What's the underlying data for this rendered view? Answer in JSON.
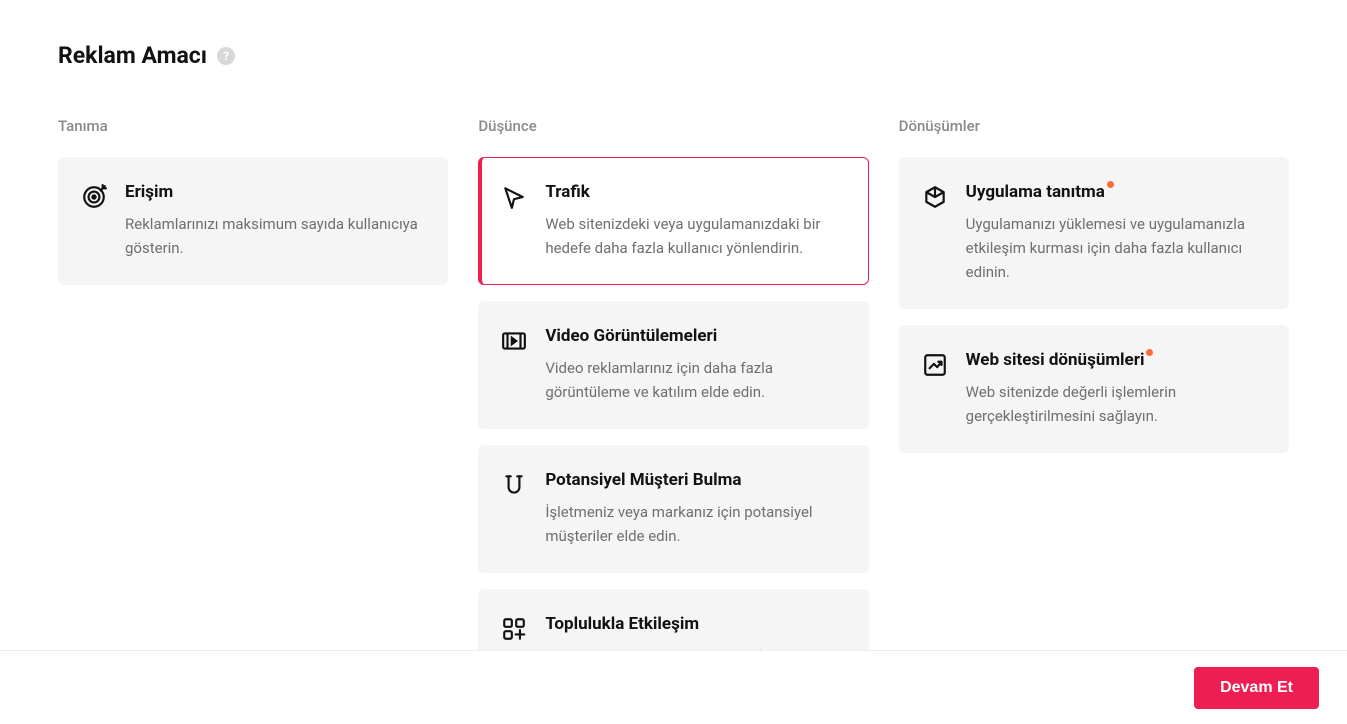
{
  "page_title": "Reklam Amacı",
  "columns": {
    "awareness": {
      "header": "Tanıma",
      "items": [
        {
          "title": "Erişim",
          "desc": "Reklamlarınızı maksimum sayıda kullanıcıya gösterin.",
          "selected": false,
          "badge": false
        }
      ]
    },
    "consideration": {
      "header": "Düşünce",
      "items": [
        {
          "title": "Trafik",
          "desc": "Web sitenizdeki veya uygulamanızdaki bir hedefe daha fazla kullanıcı yönlendirin.",
          "selected": true,
          "badge": false
        },
        {
          "title": "Video Görüntülemeleri",
          "desc": "Video reklamlarınız için daha fazla görüntüleme ve katılım elde edin.",
          "selected": false,
          "badge": false
        },
        {
          "title": "Potansiyel Müşteri Bulma",
          "desc": "İşletmeniz veya markanız için potansiyel müşteriler elde edin.",
          "selected": false,
          "badge": false
        },
        {
          "title": "Toplulukla Etkileşim",
          "desc": "Daha fazla sayfa takibi veya profil ziyareti",
          "selected": false,
          "badge": false
        }
      ]
    },
    "conversions": {
      "header": "Dönüşümler",
      "items": [
        {
          "title": "Uygulama tanıtma",
          "desc": "Uygulamanızı yüklemesi ve uygulamanızla etkileşim kurması için daha fazla kullanıcı edinin.",
          "selected": false,
          "badge": true
        },
        {
          "title": "Web sitesi dönüşümleri",
          "desc": "Web sitenizde değerli işlemlerin gerçekleştirilmesini sağlayın.",
          "selected": false,
          "badge": true
        }
      ]
    }
  },
  "footer": {
    "continue_label": "Devam Et"
  }
}
